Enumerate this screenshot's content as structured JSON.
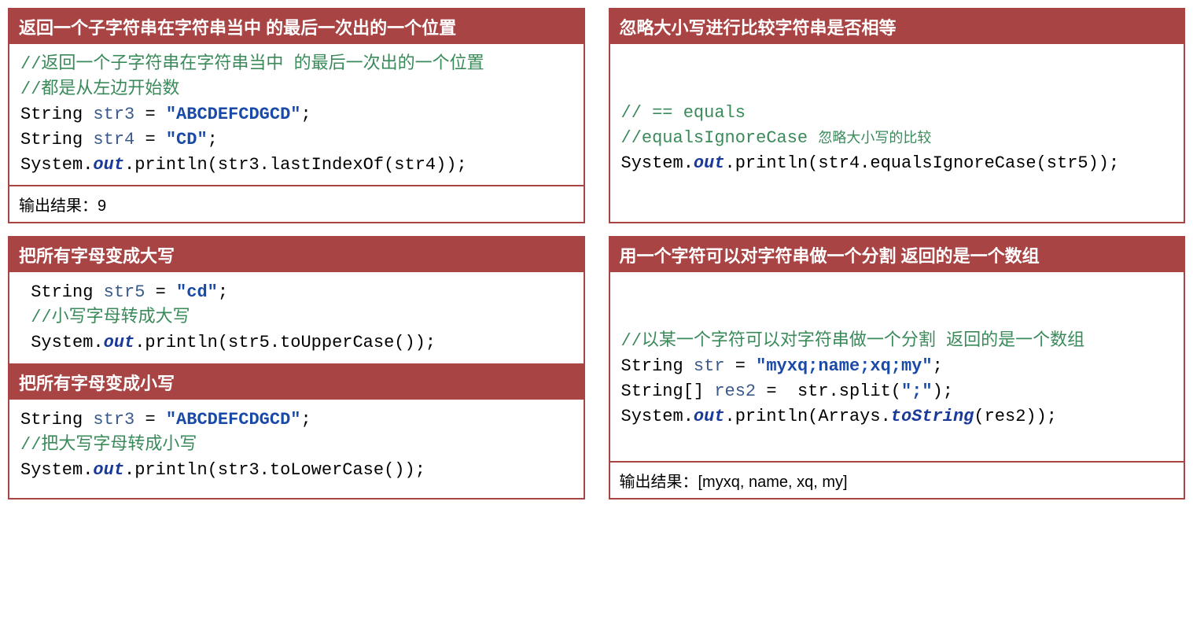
{
  "cards": {
    "c1": {
      "title": "返回一个子字符串在字符串当中 的最后一次出的一个位置",
      "code": {
        "cm1a": "//",
        "cm1b": "返回一个子字符串在字符串当中 的最后一次出的一个位置",
        "cm2a": "//",
        "cm2b": "都是从左边开始数",
        "l3_type": "String ",
        "l3_var": "str3 ",
        "l3_eq": "= ",
        "l3_str": "\"ABCDEFCDGCD\"",
        "l3_end": ";",
        "l4_type": "String ",
        "l4_var": "str4 ",
        "l4_eq": "= ",
        "l4_str": "\"CD\"",
        "l4_end": ";",
        "l5_a": "System.",
        "l5_out": "out",
        "l5_b": ".println(str3.lastIndexOf(str4));"
      },
      "footer": "输出结果：9"
    },
    "c2": {
      "title": "忽略大小写进行比较字符串是否相等",
      "code": {
        "cm1": "// == equals",
        "cm2a": "//equalsIgnoreCase ",
        "cm2b": "忽略大小写的比较",
        "l3_a": "System.",
        "l3_out": "out",
        "l3_b": ".println(str4.equalsIgnoreCase(str5));"
      }
    },
    "c3": {
      "title": "把所有字母变成大写",
      "code": {
        "l1_type": " String ",
        "l1_var": "str5 ",
        "l1_eq": "= ",
        "l1_str": "\"cd\"",
        "l1_end": ";",
        "cm2a": " //",
        "cm2b": "小写字母转成大写",
        "l3_a": " System.",
        "l3_out": "out",
        "l3_b": ".println(str5.toUpperCase());"
      },
      "title2": "把所有字母变成小写",
      "code2": {
        "l1_type": "String ",
        "l1_var": "str3 ",
        "l1_eq": "= ",
        "l1_str": "\"ABCDEFCDGCD\"",
        "l1_end": ";",
        "cm2a": "//",
        "cm2b": "把大写字母转成小写",
        "l3_a": "System.",
        "l3_out": "out",
        "l3_b": ".println(str3.toLowerCase());"
      }
    },
    "c4": {
      "title": "用一个字符可以对字符串做一个分割 返回的是一个数组",
      "code": {
        "cm1a": "//",
        "cm1b": "以某一个字符可以对字符串做一个分割 返回的是一个数组",
        "l2_type": "String ",
        "l2_var": "str ",
        "l2_eq": "= ",
        "l2_str": "\"myxq;name;xq;my\"",
        "l2_end": ";",
        "l3_type": "String[] ",
        "l3_var": "res2 ",
        "l3_eq": "=  ",
        "l3_b": "str.split(",
        "l3_str": "\";\"",
        "l3_c": ");",
        "l4_a": "System.",
        "l4_out": "out",
        "l4_b": ".println(Arrays.",
        "l4_ts": "toString",
        "l4_c": "(res2));"
      },
      "footer": "输出结果：[myxq, name, xq, my]"
    }
  }
}
